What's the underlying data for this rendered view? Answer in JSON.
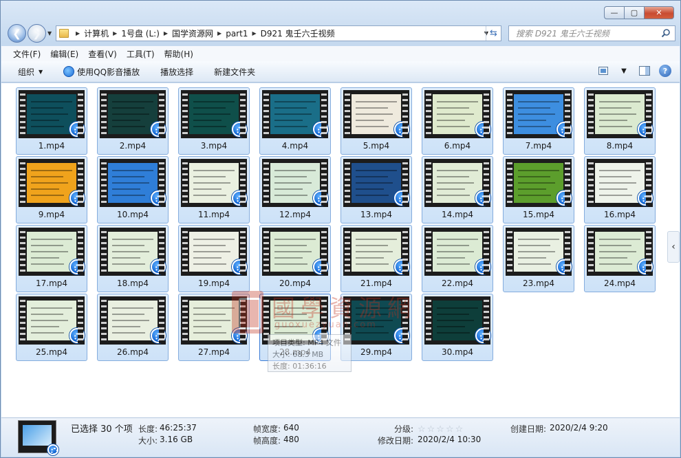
{
  "window": {
    "min_label": "—",
    "max_label": "▢",
    "close_label": "✕"
  },
  "address": {
    "crumbs": [
      "计算机",
      "1号盘 (L:)",
      "国学资源网",
      "part1",
      "D921 鬼壬六壬视频"
    ],
    "search_placeholder": "搜索 D921 鬼壬六壬视频"
  },
  "menubar": [
    "文件(F)",
    "编辑(E)",
    "查看(V)",
    "工具(T)",
    "帮助(H)"
  ],
  "toolbar": {
    "organize": "组织",
    "play_qq": "使用QQ影音播放",
    "play_selection": "播放选择",
    "new_folder": "新建文件夹",
    "help": "?"
  },
  "files": [
    {
      "name": "1.mp4",
      "bg": "#0e4f5c"
    },
    {
      "name": "2.mp4",
      "bg": "#153f3c"
    },
    {
      "name": "3.mp4",
      "bg": "#0f4f4a"
    },
    {
      "name": "4.mp4",
      "bg": "#1a6e88"
    },
    {
      "name": "5.mp4",
      "bg": "#efeadd"
    },
    {
      "name": "6.mp4",
      "bg": "#dfeacd"
    },
    {
      "name": "7.mp4",
      "bg": "#3d8ee0"
    },
    {
      "name": "8.mp4",
      "bg": "#dbead0"
    },
    {
      "name": "9.mp4",
      "bg": "#f0a31c"
    },
    {
      "name": "10.mp4",
      "bg": "#2f7ed8"
    },
    {
      "name": "11.mp4",
      "bg": "#eaf0e0"
    },
    {
      "name": "12.mp4",
      "bg": "#d8ead8"
    },
    {
      "name": "13.mp4",
      "bg": "#1f4f8c"
    },
    {
      "name": "14.mp4",
      "bg": "#e1ecd6"
    },
    {
      "name": "15.mp4",
      "bg": "#5c9e2c"
    },
    {
      "name": "16.mp4",
      "bg": "#eef3ea"
    },
    {
      "name": "17.mp4",
      "bg": "#dcebd4"
    },
    {
      "name": "18.mp4",
      "bg": "#e3eedb"
    },
    {
      "name": "19.mp4",
      "bg": "#eef0e5"
    },
    {
      "name": "20.mp4",
      "bg": "#dcebd4"
    },
    {
      "name": "21.mp4",
      "bg": "#e5eedb"
    },
    {
      "name": "22.mp4",
      "bg": "#dcebd4"
    },
    {
      "name": "23.mp4",
      "bg": "#e9f0e2"
    },
    {
      "name": "24.mp4",
      "bg": "#dcebd4"
    },
    {
      "name": "25.mp4",
      "bg": "#e3eedb"
    },
    {
      "name": "26.mp4",
      "bg": "#e9efe0"
    },
    {
      "name": "27.mp4",
      "bg": "#e6eedb"
    },
    {
      "name": "28.mp4",
      "bg": "#dcebd4"
    },
    {
      "name": "29.mp4",
      "bg": "#0f4a52"
    },
    {
      "name": "30.mp4",
      "bg": "#0e3e3a"
    }
  ],
  "tooltip": {
    "line1": "项目类型: MP4 文件",
    "line2": "大小: 68.3 MB",
    "line3": "长度: 01:36:16"
  },
  "watermark": {
    "text": "國學資源網",
    "url": "guoxuezyuan.com"
  },
  "status": {
    "selected": "已选择 30 个项",
    "length_label": "长度:",
    "length": "46:25:37",
    "size_label": "大小:",
    "size": "3.16 GB",
    "frame_width_label": "帧宽度:",
    "frame_width": "640",
    "frame_height_label": "帧高度:",
    "frame_height": "480",
    "rating_label": "分级:",
    "rating": 0,
    "created_label": "创建日期:",
    "created": "2020/2/4 9:20",
    "modified_label": "修改日期:",
    "modified": "2020/2/4 10:30"
  }
}
